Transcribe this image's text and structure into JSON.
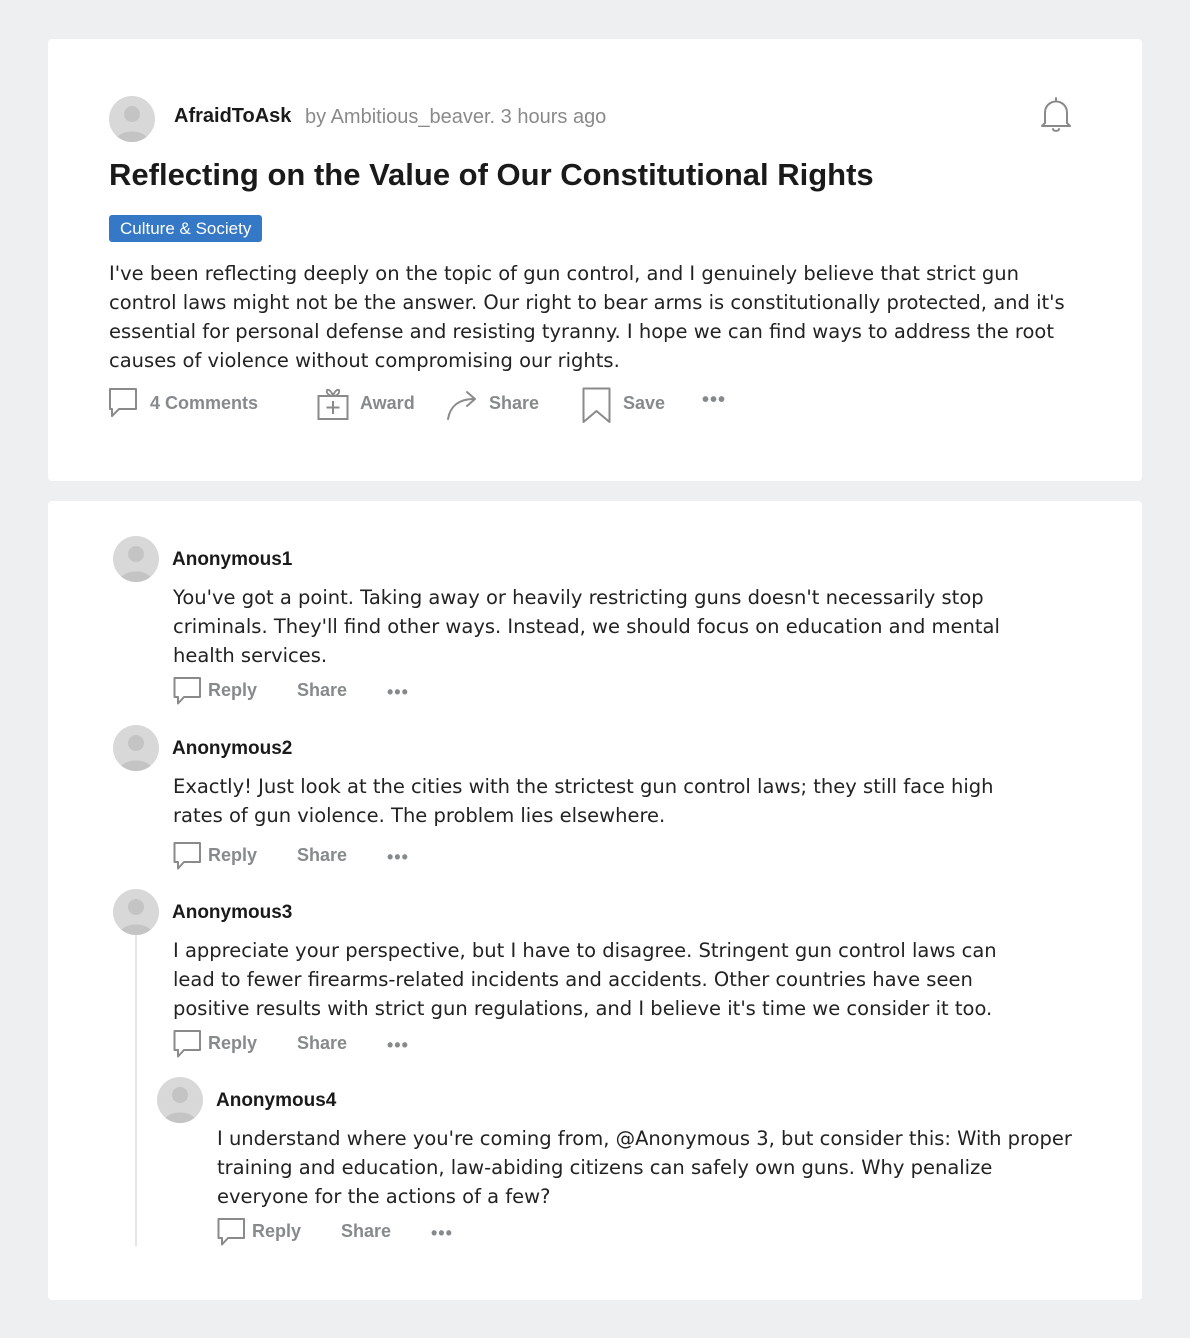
{
  "post": {
    "community": "AfraidToAsk",
    "byline": "by Ambitious_beaver. 3 hours ago",
    "title": "Reflecting on the Value of Our Constitutional Rights",
    "flair": "Culture & Society",
    "body": "I've been reflecting deeply on the topic of gun control, and I genuinely believe that strict gun control laws might not be the answer. Our right to bear arms is constitutionally protected, and it's essential for personal defense and resisting tyranny. I hope we can find ways to address the root causes of violence without compromising our rights.",
    "actions": {
      "comments": "4 Comments",
      "award": "Award",
      "share": "Share",
      "save": "Save",
      "more": "•••"
    }
  },
  "comments": [
    {
      "author": "Anonymous1",
      "body": "You've got a point. Taking away or heavily restricting guns doesn't necessarily stop criminals. They'll find other ways. Instead, we should focus on education and mental health services.",
      "reply": "Reply",
      "share": "Share",
      "more": "•••"
    },
    {
      "author": "Anonymous2",
      "body": "Exactly! Just look at the cities with the strictest gun control laws; they still face high rates of gun violence. The problem lies elsewhere.",
      "reply": "Reply",
      "share": "Share",
      "more": "•••"
    },
    {
      "author": "Anonymous3",
      "body": "I appreciate your perspective, but I have to disagree. Stringent gun control laws can lead to fewer firearms-related incidents and accidents. Other countries have seen positive results with strict gun regulations, and I believe it's time we consider it too.",
      "reply": "Reply",
      "share": "Share",
      "more": "•••"
    },
    {
      "author": "Anonymous4",
      "body": "I understand where you're coming from, @Anonymous 3, but consider this: With proper training and education, law-abiding citizens can safely own guns. Why penalize everyone for the actions of a few?",
      "reply": "Reply",
      "share": "Share",
      "more": "•••"
    }
  ],
  "colors": {
    "page_bg": "#eeeff1",
    "card_bg": "#ffffff",
    "flair_bg": "#3478c6",
    "muted": "#878a8c"
  },
  "icons": [
    "avatar-icon",
    "bell-icon",
    "comment-icon",
    "gift-icon",
    "share-arrow-icon",
    "bookmark-icon",
    "more-dots-icon"
  ]
}
